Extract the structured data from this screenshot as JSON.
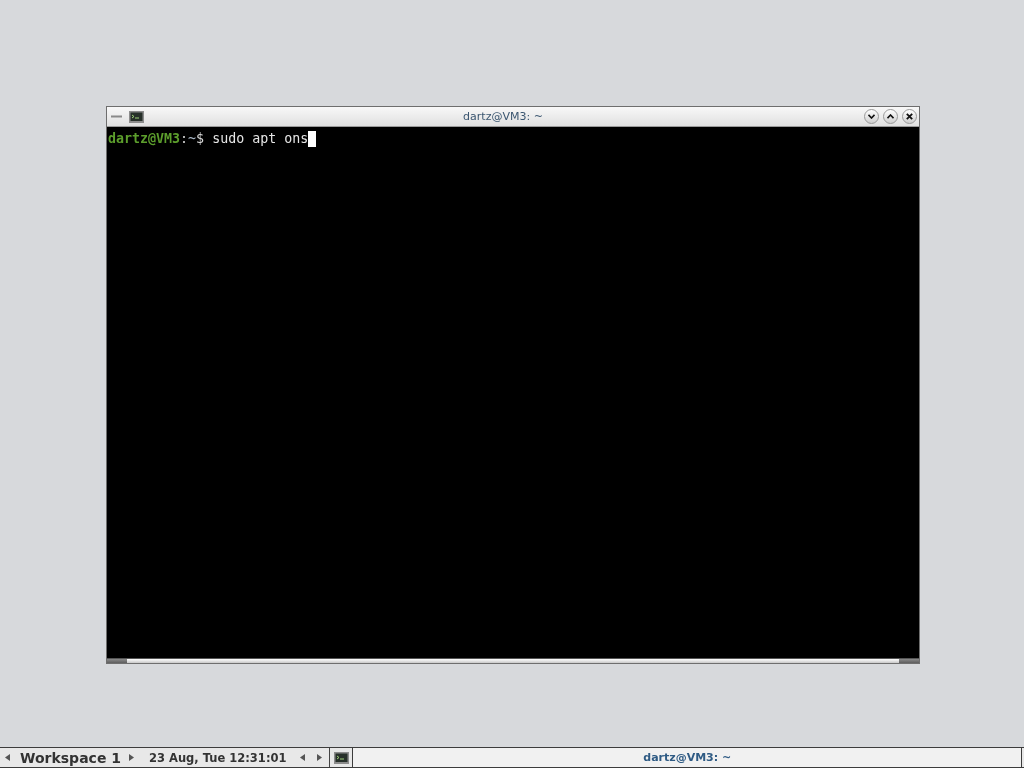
{
  "window": {
    "title": "dartz@VM3: ~"
  },
  "terminal": {
    "lines": [
      {
        "user_host": "dartz@VM3",
        "separator": ":",
        "path": "~",
        "prompt": "$",
        "command": "sudo apt ons",
        "cursor": true
      }
    ]
  },
  "taskbar": {
    "workspace": "Workspace 1",
    "clock": "23 Aug, Tue 12:31:01",
    "tasks": [
      {
        "title": "dartz@VM3: ~",
        "selected": true
      }
    ]
  }
}
